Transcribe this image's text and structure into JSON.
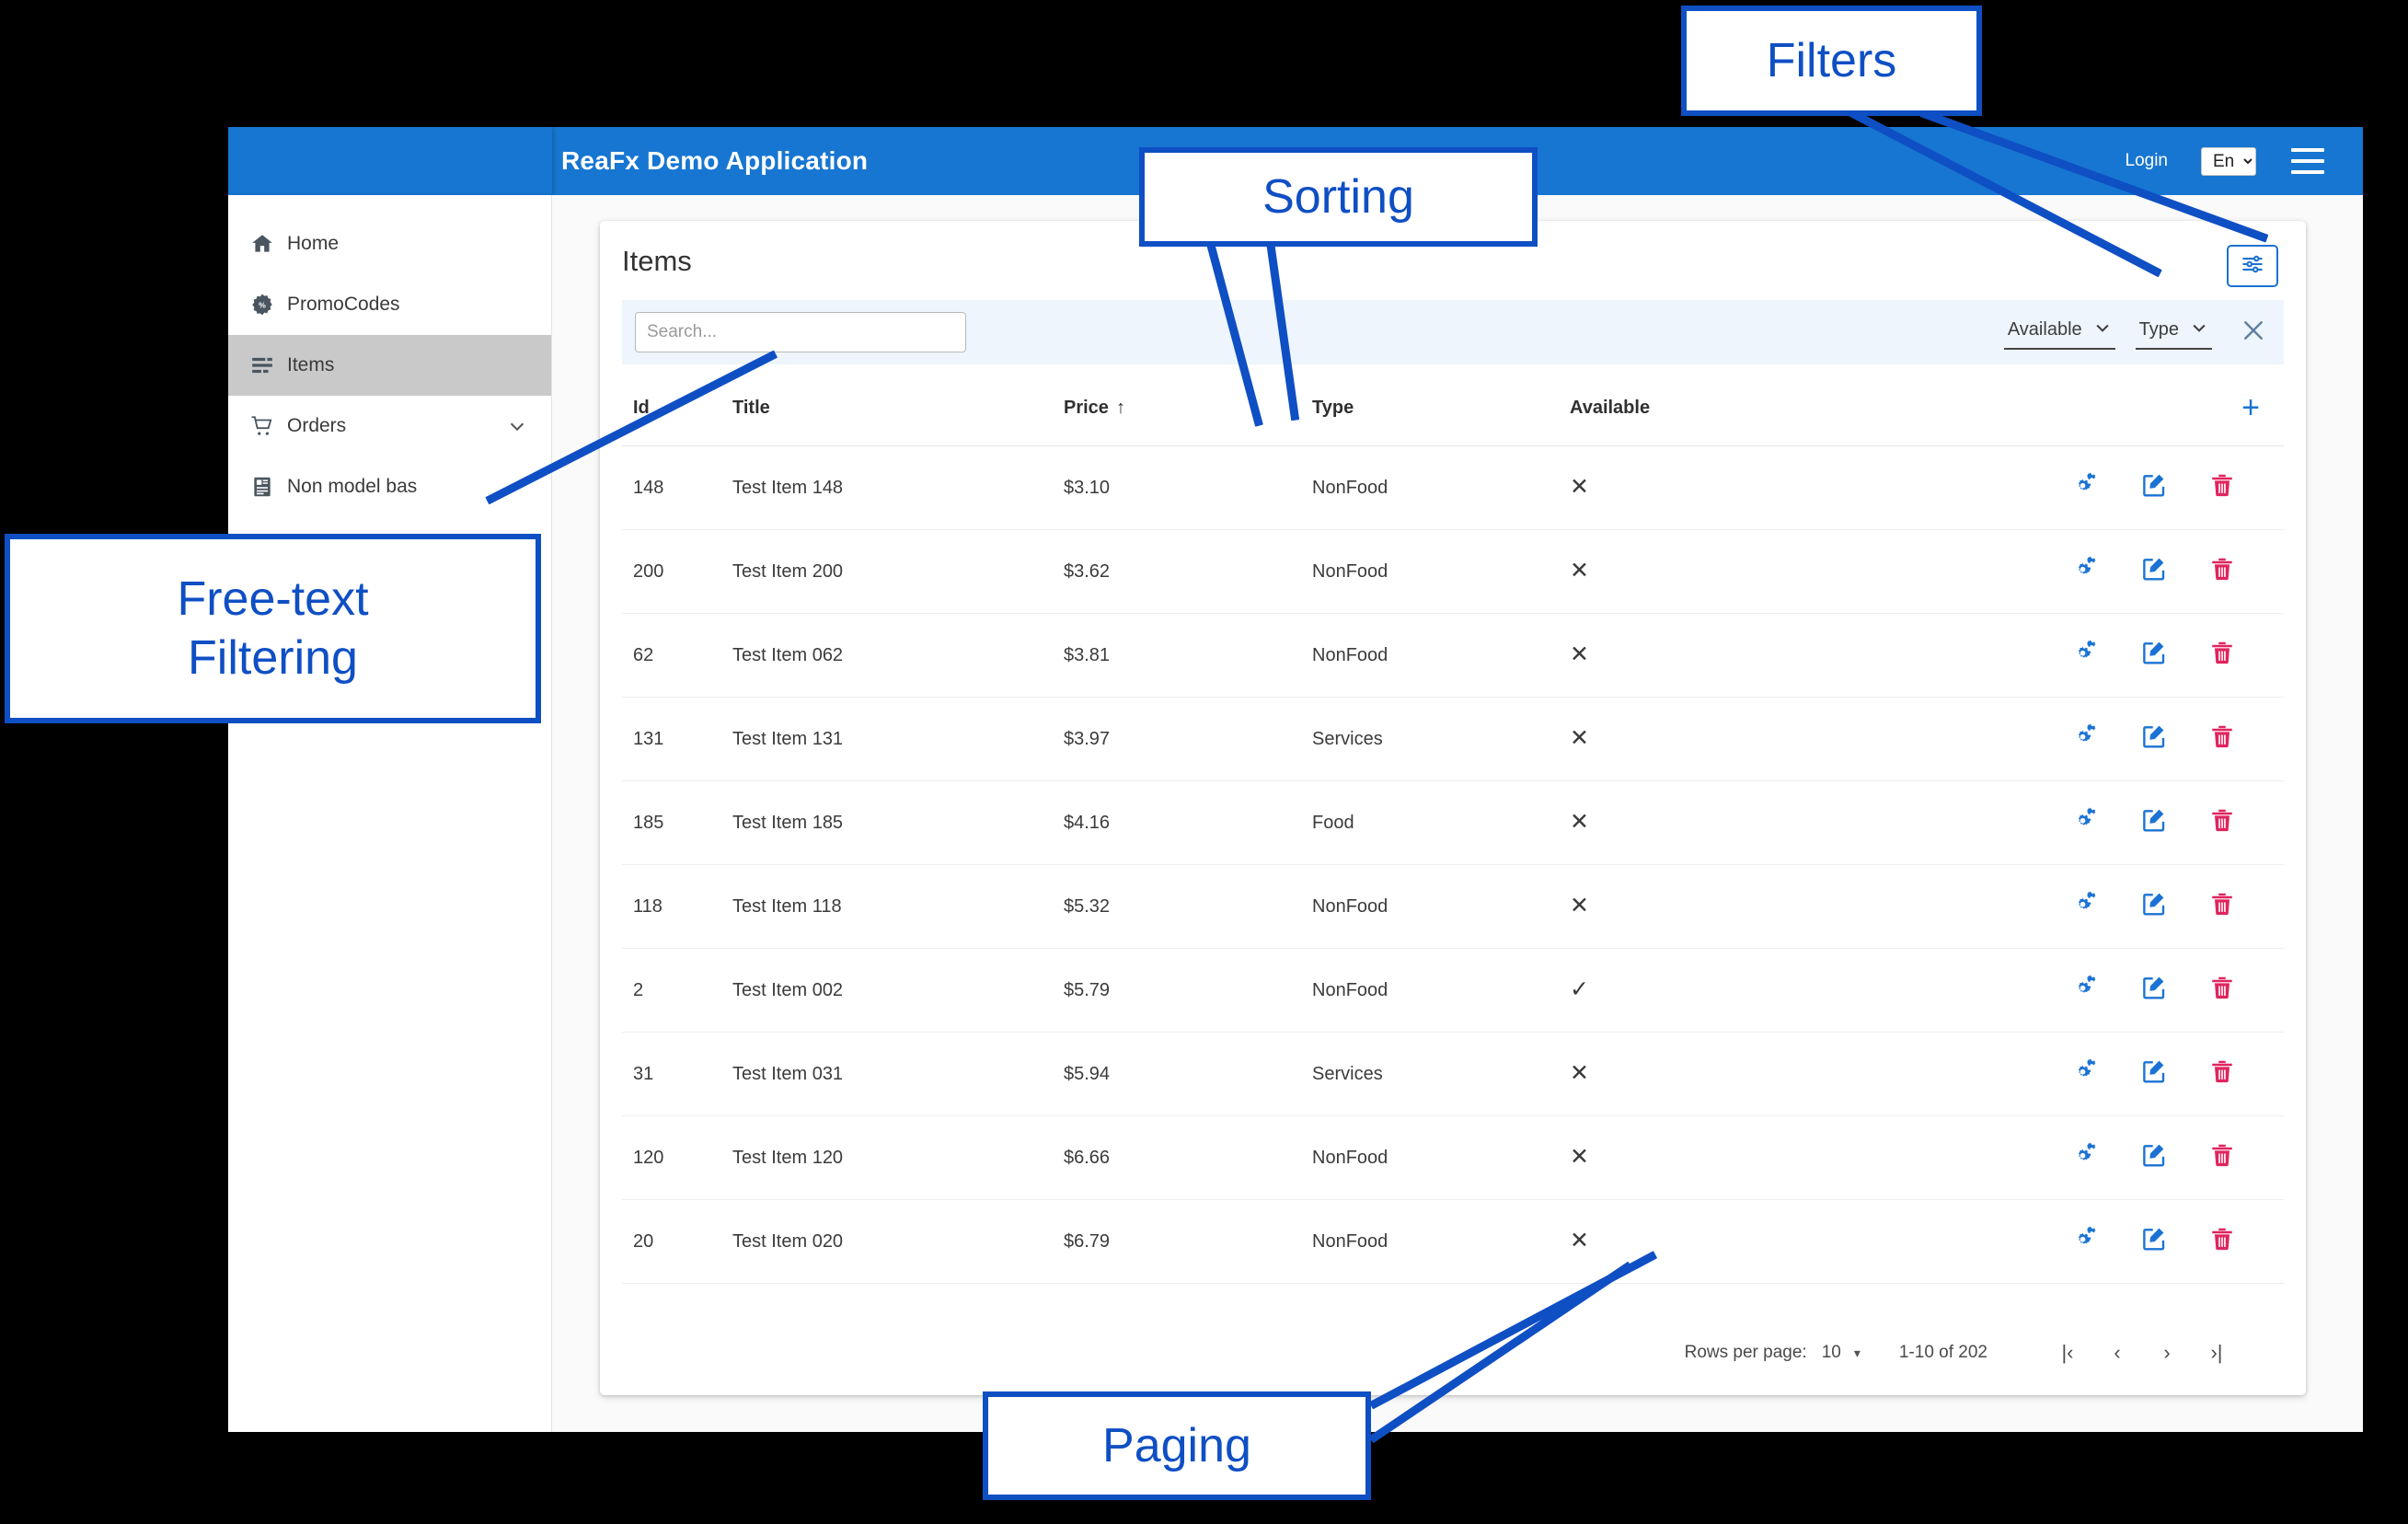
{
  "topbar": {
    "app_title": "ReaFx Demo Application",
    "login_label": "Login",
    "language_value": "En",
    "language_options": [
      "En"
    ],
    "menu_icon": "hamburger-icon"
  },
  "sidebar": {
    "items": [
      {
        "label": "Home",
        "icon": "home-icon",
        "active": false,
        "expandable": false
      },
      {
        "label": "PromoCodes",
        "icon": "promo-percent-icon",
        "active": false,
        "expandable": false
      },
      {
        "label": "Items",
        "icon": "list-icon",
        "active": true,
        "expandable": false
      },
      {
        "label": "Orders",
        "icon": "cart-icon",
        "active": false,
        "expandable": true
      },
      {
        "label": "Non model bas",
        "icon": "document-icon",
        "active": false,
        "expandable": false
      }
    ]
  },
  "card": {
    "title": "Items",
    "filter_toggle_icon": "sliders-icon"
  },
  "filter_bar": {
    "search_value": "",
    "search_placeholder": "Search...",
    "available_filter_label": "Available",
    "type_filter_label": "Type",
    "clear_icon": "close-x-icon"
  },
  "table": {
    "columns": [
      {
        "key": "id",
        "label": "Id",
        "sorted": false
      },
      {
        "key": "title",
        "label": "Title",
        "sorted": false
      },
      {
        "key": "price",
        "label": "Price",
        "sorted": true,
        "sort_direction": "asc",
        "sort_arrow": "↑"
      },
      {
        "key": "type",
        "label": "Type",
        "sorted": false
      },
      {
        "key": "available",
        "label": "Available",
        "sorted": false
      }
    ],
    "add_label": "+",
    "row_action_icons": [
      "settings-gears-icon",
      "edit-pencil-icon",
      "delete-trash-icon"
    ],
    "available_true_mark": "✓",
    "available_false_mark": "✕",
    "rows": [
      {
        "id": "148",
        "title": "Test Item 148",
        "price": "$3.10",
        "type": "NonFood",
        "available": false
      },
      {
        "id": "200",
        "title": "Test Item 200",
        "price": "$3.62",
        "type": "NonFood",
        "available": false
      },
      {
        "id": "62",
        "title": "Test Item 062",
        "price": "$3.81",
        "type": "NonFood",
        "available": false
      },
      {
        "id": "131",
        "title": "Test Item 131",
        "price": "$3.97",
        "type": "Services",
        "available": false
      },
      {
        "id": "185",
        "title": "Test Item 185",
        "price": "$4.16",
        "type": "Food",
        "available": false
      },
      {
        "id": "118",
        "title": "Test Item 118",
        "price": "$5.32",
        "type": "NonFood",
        "available": false
      },
      {
        "id": "2",
        "title": "Test Item 002",
        "price": "$5.79",
        "type": "NonFood",
        "available": true
      },
      {
        "id": "31",
        "title": "Test Item 031",
        "price": "$5.94",
        "type": "Services",
        "available": false
      },
      {
        "id": "120",
        "title": "Test Item 120",
        "price": "$6.66",
        "type": "NonFood",
        "available": false
      },
      {
        "id": "20",
        "title": "Test Item 020",
        "price": "$6.79",
        "type": "NonFood",
        "available": false
      }
    ]
  },
  "paginator": {
    "rows_per_page_label": "Rows per page:",
    "rows_per_page_value": "10",
    "caret": "▾",
    "range_label": "1-10 of 202",
    "first_page_icon": "|‹",
    "prev_page_icon": "‹",
    "next_page_icon": "›",
    "last_page_icon": "›|"
  },
  "callouts": {
    "filters": "Filters",
    "sorting": "Sorting",
    "free_text_line1": "Free-text",
    "free_text_line2": "Filtering",
    "paging": "Paging"
  },
  "colors": {
    "brand_blue": "#1776d1",
    "callout_blue": "#0f4fc4",
    "action_blue": "#1a73d4",
    "delete_red": "#e0245e",
    "filter_bar_bg": "#eef5fd",
    "active_nav_bg": "#c9c9c9"
  }
}
